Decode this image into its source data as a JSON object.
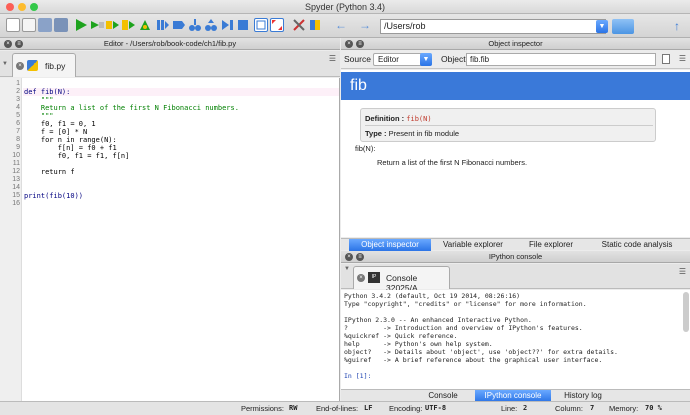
{
  "window": {
    "title": "Spyder (Python 3.4)"
  },
  "toolbar": {
    "path": "/Users/rob"
  },
  "editor": {
    "panel_title": "Editor - /Users/rob/book-code/ch1/fib.py",
    "tab_label": "fib.py",
    "line_numbers": [
      "1",
      "2",
      "3",
      "4",
      "5",
      "6",
      "7",
      "8",
      "9",
      "10",
      "11",
      "12",
      "13",
      "14",
      "15",
      "16"
    ],
    "code_lines": [
      "",
      "def fib(N):",
      "    \"\"\"",
      "    Return a list of the first N Fibonacci numbers.",
      "    \"\"\"",
      "    f0, f1 = 0, 1",
      "    f = [0] * N",
      "    for n in range(N):",
      "        f[n] = f0 + f1",
      "        f0, f1 = f1, f[n]",
      "",
      "    return f",
      "",
      "",
      "print(fib(10))",
      ""
    ]
  },
  "object_inspector": {
    "panel_title": "Object inspector",
    "source_label": "Source",
    "source_value": "Editor",
    "object_label": "Object",
    "object_value": "fib.fib",
    "header": "fib",
    "definition_label": "Definition :",
    "definition_value": "fib(N)",
    "type_label": "Type :",
    "type_value": "Present in fib module",
    "doc_signature": "fib(N):",
    "doc_text": "Return a list of the first N Fibonacci numbers.",
    "tabs": [
      "Object inspector",
      "Variable explorer",
      "File explorer",
      "Static code analysis"
    ]
  },
  "console": {
    "panel_title": "IPython console",
    "tab_label": "Console 32025/A",
    "lines": [
      "Python 3.4.2 (default, Oct 19 2014, 08:26:16)",
      "Type \"copyright\", \"credits\" or \"license\" for more information.",
      "",
      "IPython 2.3.0 -- An enhanced Interactive Python.",
      "?         -> Introduction and overview of IPython's features.",
      "%quickref -> Quick reference.",
      "help      -> Python's own help system.",
      "object?   -> Details about 'object', use 'object??' for extra details.",
      "%guiref   -> A brief reference about the graphical user interface.",
      "",
      "In [1]:"
    ],
    "tabs": [
      "Console",
      "IPython console",
      "History log"
    ]
  },
  "status": {
    "permissions_label": "Permissions:",
    "permissions_value": "RW",
    "eol_label": "End-of-lines:",
    "eol_value": "LF",
    "encoding_label": "Encoding:",
    "encoding_value": "UTF-8",
    "line_label": "Line:",
    "line_value": "2",
    "column_label": "Column:",
    "column_value": "7",
    "memory_label": "Memory:",
    "memory_value": "70 %"
  },
  "colors": {
    "accent": "#3a79d9",
    "tab_selected": "#2b74e6"
  }
}
